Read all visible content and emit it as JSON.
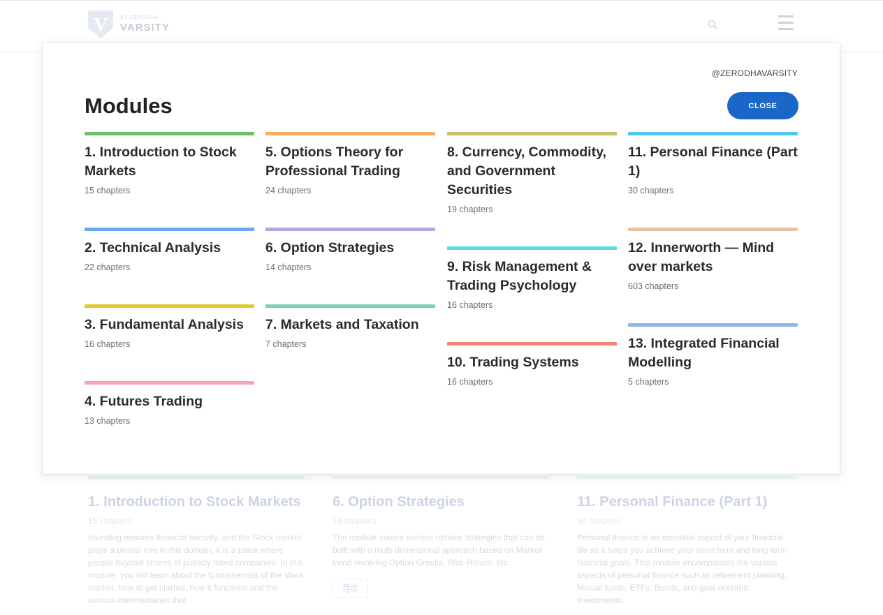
{
  "background": {
    "logo": {
      "mark": "V",
      "small_text": "BY ZERODHA",
      "brand": "VARSITY"
    },
    "cards": [
      {
        "title": "1. Introduction to Stock Markets",
        "chapters": "15 chapters",
        "description": "Investing ensures financial security, and the Stock market plays a pivotal role in this domain, it is a place where people buy/sell shares of publicly listed companies. In this module, you will learn about the fundamentals of the stock market, how to get started, how it functions and the various intermediaries that",
        "color": "#a5d6a7"
      },
      {
        "title": "6. Option Strategies",
        "chapters": "14 chapters",
        "description": "The module covers various options strategies that can be built with a multi-dimensional approach based on Market trend involving Option Greeks, Risk-Return, etc.",
        "lang_button": "हिंदी",
        "color": "#c5cae9"
      },
      {
        "title": "11. Personal Finance (Part 1)",
        "chapters": "30 chapters",
        "description": "Personal finance is an essential aspect of your financial life as it helps you achieve your short term and long term financial goals. This module encompasses the various aspects of personal finance such as retirement planning, Mutual funds, ETFs, Bonds, and goal-oriented investments.",
        "color": "#b2ebf2"
      }
    ]
  },
  "modal": {
    "handle": "@ZERODHAVARSITY",
    "title": "Modules",
    "close_label": "CLOSE",
    "columns": [
      [
        {
          "title": "1. Introduction to Stock Markets",
          "chapters": "15 chapters",
          "color": "#6cc26b"
        },
        {
          "title": "2. Technical Analysis",
          "chapters": "22 chapters",
          "color": "#6aa9f0"
        },
        {
          "title": "3. Fundamental Analysis",
          "chapters": "16 chapters",
          "color": "#e3c930"
        },
        {
          "title": "4. Futures Trading",
          "chapters": "13 chapters",
          "color": "#f4a7b1"
        }
      ],
      [
        {
          "title": "5. Options Theory for Professional Trading",
          "chapters": "24 chapters",
          "color": "#f3b062"
        },
        {
          "title": "6. Option Strategies",
          "chapters": "14 chapters",
          "color": "#b4a8e2"
        },
        {
          "title": "7. Markets and Taxation",
          "chapters": "7 chapters",
          "color": "#7dd4b0"
        }
      ],
      [
        {
          "title": "8. Currency, Commodity, and Government Securities",
          "chapters": "19 chapters",
          "color": "#c9c070"
        },
        {
          "title": "9. Risk Management & Trading Psychology",
          "chapters": "16 chapters",
          "color": "#5ed8e4"
        },
        {
          "title": "10. Trading Systems",
          "chapters": "16 chapters",
          "color": "#f08674"
        }
      ],
      [
        {
          "title": "11. Personal Finance (Part 1)",
          "chapters": "30 chapters",
          "color": "#4fc8f0"
        },
        {
          "title": "12. Innerworth — Mind over markets",
          "chapters": "603 chapters",
          "color": "#e8c3a3"
        },
        {
          "title": "13. Integrated Financial Modelling",
          "chapters": "5 chapters",
          "color": "#95b4ec"
        }
      ]
    ]
  }
}
